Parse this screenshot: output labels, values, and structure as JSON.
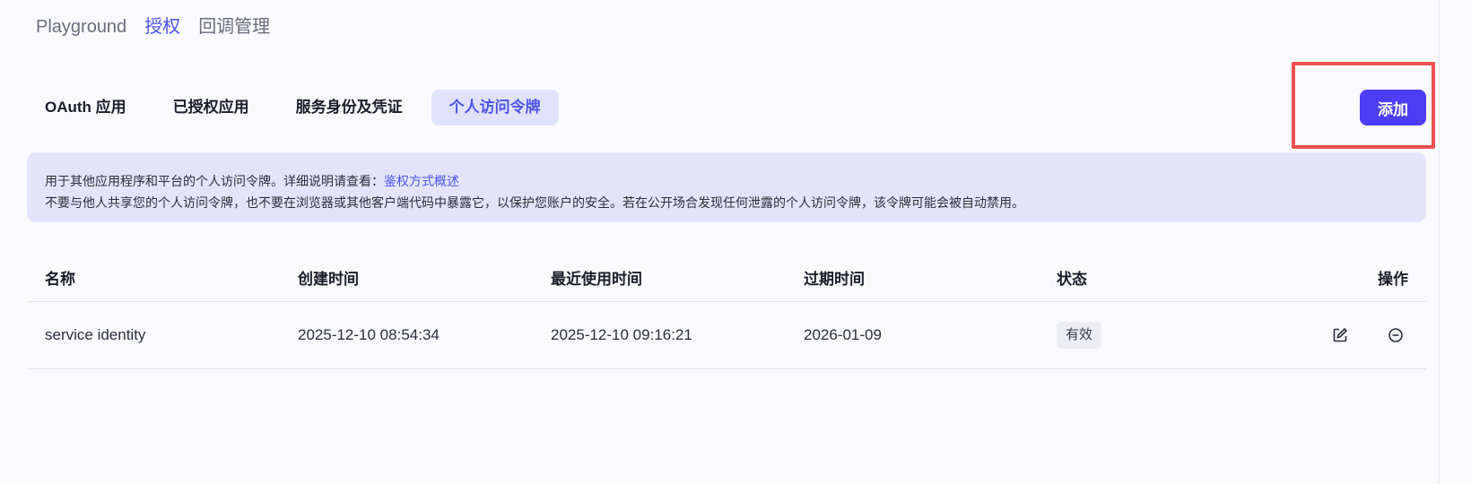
{
  "topnav": {
    "items": [
      {
        "label": "Playground",
        "active": false
      },
      {
        "label": "授权",
        "active": true
      },
      {
        "label": "回调管理",
        "active": false
      }
    ]
  },
  "subtabs": [
    {
      "label": "OAuth 应用",
      "active": false
    },
    {
      "label": "已授权应用",
      "active": false
    },
    {
      "label": "服务身份及凭证",
      "active": false
    },
    {
      "label": "个人访问令牌",
      "active": true
    }
  ],
  "actions": {
    "add_label": "添加"
  },
  "info": {
    "line1_prefix": "用于其他应用程序和平台的个人访问令牌。详细说明请查看：",
    "line1_link": "鉴权方式概述",
    "line2": "不要与他人共享您的个人访问令牌，也不要在浏览器或其他客户端代码中暴露它，以保护您账户的安全。若在公开场合发现任何泄露的个人访问令牌，该令牌可能会被自动禁用。"
  },
  "table": {
    "columns": [
      "名称",
      "创建时间",
      "最近使用时间",
      "过期时间",
      "状态",
      "操作"
    ],
    "rows": [
      {
        "name": "service identity",
        "created": "2025-12-10 08:54:34",
        "last_used": "2025-12-10 09:16:21",
        "expires": "2026-01-09",
        "status": "有效"
      }
    ]
  },
  "colors": {
    "accent": "#4d53e8",
    "button": "#4d3df5",
    "highlight": "#ef5151"
  }
}
